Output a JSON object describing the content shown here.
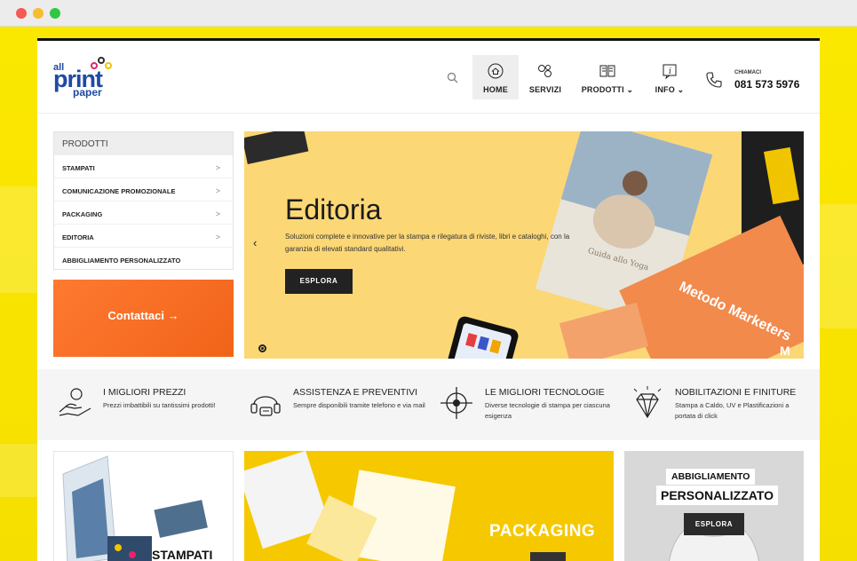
{
  "brand": {
    "logo_all": "all",
    "logo_print": "print",
    "logo_paper": "paper"
  },
  "nav": {
    "items": [
      {
        "label": "HOME"
      },
      {
        "label": "SERVIZI"
      },
      {
        "label": "PRODOTTI ⌄"
      },
      {
        "label": "INFO ⌄"
      }
    ],
    "call_label": "CHIAMACI",
    "phone": "081 573 5976"
  },
  "menu": {
    "title": "PRODOTTI",
    "items": [
      {
        "label": "STAMPATI",
        "chevron": ">"
      },
      {
        "label": "COMUNICAZIONE PROMOZIONALE",
        "chevron": ">"
      },
      {
        "label": "PACKAGING",
        "chevron": ">"
      },
      {
        "label": "EDITORIA",
        "chevron": ">"
      },
      {
        "label": "ABBIGLIAMENTO PERSONALIZZATO",
        "chevron": ""
      }
    ]
  },
  "contact": {
    "label": "Contattaci →"
  },
  "hero": {
    "title": "Editoria",
    "description": "Soluzioni complete e innovative per la stampa e rilegatura di riviste, libri e cataloghi, con la garanzia di elevati standard qualitativi.",
    "button": "ESPLORA",
    "prev_arrow": "‹",
    "book_title": "Guida allo Yoga",
    "book_title_2": "Metodo Marketers",
    "book_title_3": "M"
  },
  "features": [
    {
      "title": "I MIGLIORI PREZZI",
      "description": "Prezzi imbattibili su tantissimi prodotti!",
      "icon": "hand-coin-icon"
    },
    {
      "title": "ASSISTENZA E PREVENTIVI",
      "description": "Sempre disponibili tramite telefono e via mail",
      "icon": "headset-icon"
    },
    {
      "title": "LE MIGLIORI TECNOLOGIE",
      "description": "Diverse tecnologie di stampa per ciascuna esigenza",
      "icon": "target-icon"
    },
    {
      "title": "NOBILITAZIONI E FINITURE",
      "description": "Stampa a Caldo, UV e Plastificazioni a portata di click",
      "icon": "diamond-icon"
    }
  ],
  "cards": {
    "stampati": "STAMPATI",
    "packaging": "PACKAGING",
    "abbigliamento_line1": "ABBIGLIAMENTO",
    "abbigliamento_line2": "PERSONALIZZATO",
    "abbigliamento_button": "ESPLORA"
  },
  "colors": {
    "accent_yellow": "#f7e300",
    "hero_bg": "#fbd776",
    "contact_orange": "#ff6a1a",
    "brand_blue": "#1f4aa3"
  }
}
